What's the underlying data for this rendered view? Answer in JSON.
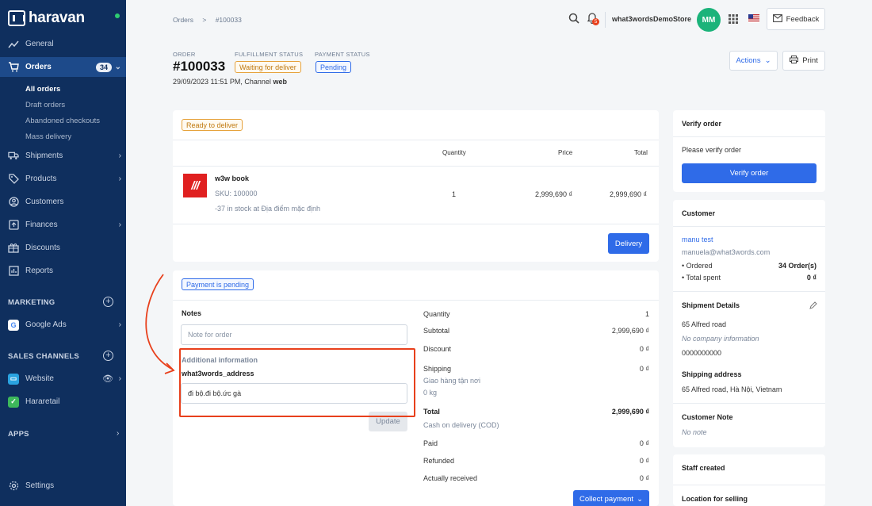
{
  "app": {
    "brand": "haravan"
  },
  "sidebar": {
    "general": "General",
    "orders": "Orders",
    "orders_count": "34",
    "orders_sub": [
      "All orders",
      "Draft orders",
      "Abandoned checkouts",
      "Mass delivery"
    ],
    "shipments": "Shipments",
    "products": "Products",
    "customers": "Customers",
    "finances": "Finances",
    "discounts": "Discounts",
    "reports": "Reports",
    "marketing": "MARKETING",
    "google_ads": "Google Ads",
    "sales_channels": "SALES CHANNELS",
    "website": "Website",
    "hararetail": "Hararetail",
    "apps": "APPS",
    "settings": "Settings"
  },
  "topbar": {
    "breadcrumb": [
      "Orders",
      ">",
      "#100033"
    ],
    "notification_count": "5",
    "store_name": "what3wordsDemoStore",
    "avatar_initials": "MM",
    "feedback": "Feedback"
  },
  "order": {
    "label": "ORDER",
    "number": "#100033",
    "fulfillment_label": "FULFILLMENT STATUS",
    "fulfillment_status": "Waiting for deliver",
    "payment_label": "PAYMENT STATUS",
    "payment_status": "Pending",
    "date_prefix": "29/09/2023 11:51 PM, Channel ",
    "channel": "web",
    "actions": "Actions",
    "print": "Print"
  },
  "fulfillment_card": {
    "status": "Ready to deliver",
    "headers": {
      "quantity": "Quantity",
      "price": "Price",
      "total": "Total"
    },
    "item": {
      "thumb_text": "///",
      "name": "w3w book",
      "sku": "SKU: 100000",
      "stock": "-37 in stock at Địa điểm mặc định",
      "quantity": "1",
      "price": "2,999,690 ₫",
      "total": "2,999,690 ₫"
    },
    "delivery_button": "Delivery"
  },
  "payment_card": {
    "status": "Payment is pending",
    "notes_label": "Notes",
    "notes_placeholder": "Note for order",
    "additional_info": "Additional information",
    "w3w_label": "what3words_address",
    "w3w_value": "đi bộ.đi bộ.ức gà",
    "update": "Update",
    "summary": {
      "quantity_label": "Quantity",
      "quantity_value": "1",
      "subtotal_label": "Subtotal",
      "subtotal_value": "2,999,690 ₫",
      "discount_label": "Discount",
      "discount_value": "0 ₫",
      "shipping_label": "Shipping",
      "shipping_value": "0 ₫",
      "shipping_method": "Giao hàng tận nơi",
      "shipping_weight": "0 kg",
      "total_label": "Total",
      "total_value": "2,999,690 ₫",
      "total_method": "Cash on delivery (COD)",
      "paid_label": "Paid",
      "paid_value": "0 ₫",
      "refunded_label": "Refunded",
      "refunded_value": "0 ₫",
      "received_label": "Actually received",
      "received_value": "0 ₫"
    },
    "collect_payment": "Collect payment"
  },
  "right_panel": {
    "verify_title": "Verify order",
    "verify_text": "Please verify order",
    "verify_button": "Verify order",
    "customer_title": "Customer",
    "customer_name": "manu test",
    "customer_email": "manuela@what3words.com",
    "ordered_label": "• Ordered",
    "ordered_value": "34 Order(s)",
    "spent_label": "• Total spent",
    "spent_value": "0 ₫",
    "shipment_title": "Shipment Details",
    "shipment_address": "65 Alfred road",
    "shipment_company": "No company information",
    "shipment_phone": "0000000000",
    "shipping_address_title": "Shipping address",
    "shipping_address": "65 Alfred road, Hà Nội, Vietnam",
    "note_title": "Customer Note",
    "note_text": "No note",
    "staff_title": "Staff created",
    "location_title": "Location for selling"
  },
  "colors": {
    "sidebar": "#0f2f5e",
    "primary": "#2f6be8",
    "highlight": "#e8401c",
    "avatar": "#1bb37a"
  }
}
